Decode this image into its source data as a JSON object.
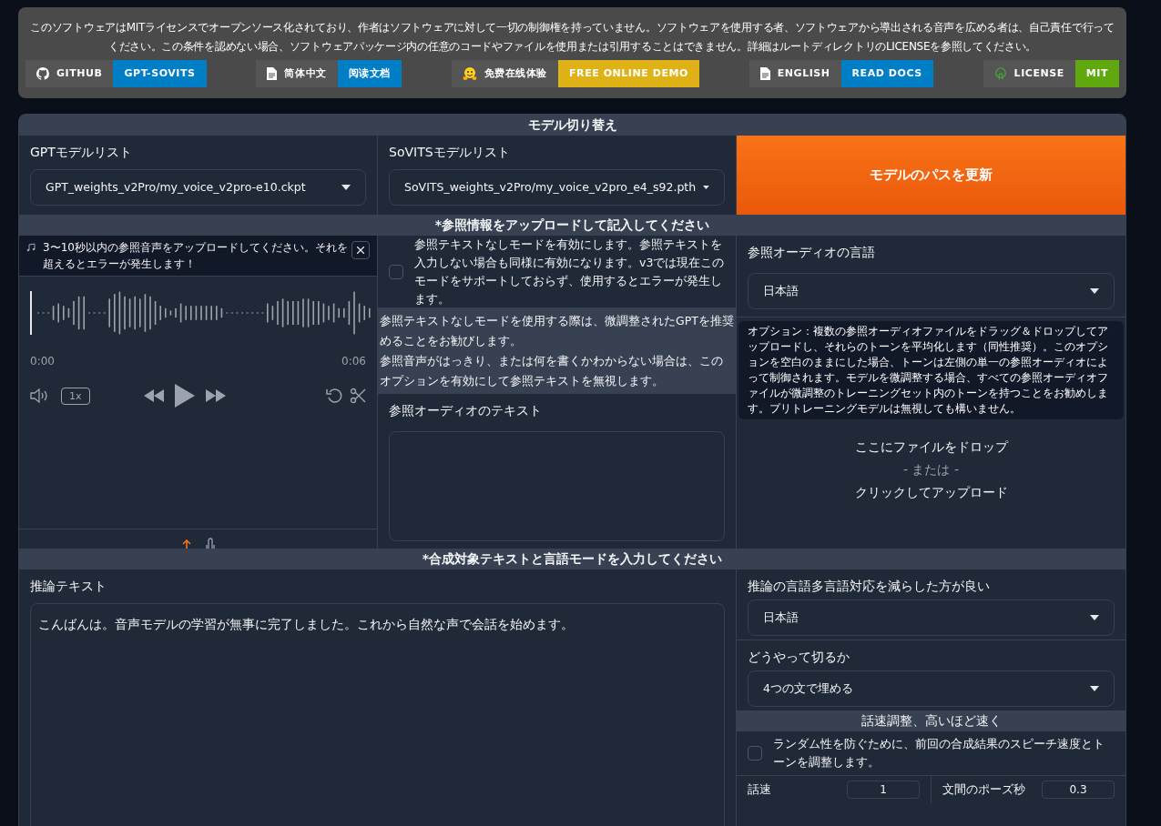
{
  "notice": "このソフトウェアはMITライセンスでオープンソース化されており、作者はソフトウェアに対して一切の制御権を持っていません。ソフトウェアを使用する者、ソフトウェアから導出される音声を広める者は、自己責任で行ってください。この条件を認めない場合、ソフトウェアパッケージ内の任意のコードやファイルを使用または引用することはできません。詳細はルートディレクトリのLICENSEを参照してください。",
  "badges": [
    {
      "kind": "github",
      "label": "GITHUB",
      "value": "GPT-SOVITS",
      "color": "#007ec6"
    },
    {
      "kind": "doc",
      "label": "简体中文",
      "value": "阅读文档",
      "color": "#007ec6"
    },
    {
      "kind": "hug",
      "label": "免费在线体验",
      "value": "FREE ONLINE DEMO",
      "color": "#dfb317"
    },
    {
      "kind": "doc",
      "label": "ENGLISH",
      "value": "READ DOCS",
      "color": "#007ec6"
    },
    {
      "kind": "license",
      "label": "LICENSE",
      "value": "MIT",
      "color": "#5fa80e"
    }
  ],
  "model_section": {
    "title": "モデル切り替え",
    "gpt": {
      "label": "GPTモデルリスト",
      "value": "GPT_weights_v2Pro/my_voice_v2pro-e10.ckpt"
    },
    "sovits": {
      "label": "SoVITSモデルリスト",
      "value": "SoVITS_weights_v2Pro/my_voice_v2pro_e4_s92.pth"
    },
    "refresh_button": "モデルのパスを更新"
  },
  "reference_section": {
    "title": "*参照情報をアップロードして記入してください",
    "audio": {
      "notice": "3〜10秒以内の参照音声をアップロードしてください。それを超えるとエラーが発生します！",
      "start_time": "0:00",
      "end_time": "0:06",
      "speed": "1x"
    },
    "no_ref_mode": {
      "label": "参照テキストなしモードを有効にします。参照テキストを入力しない場合も同様に有効になります。v3では現在このモードをサポートしておらず、使用するとエラーが発生します。",
      "checked": false
    },
    "hint": [
      "参照テキストなしモードを使用する際は、微調整されたGPTを推奨めることをお勧びします。",
      "参照音声がはっきり、または何を書くかわからない場合は、このオプションを有効にして参照テキストを無視します。"
    ],
    "ref_text": {
      "label": "参照オーディオのテキスト"
    },
    "ref_language": {
      "label": "参照オーディオの言語",
      "value": "日本語"
    },
    "tooltip": "オプション：複数の参照オーディオファイルをドラッグ＆ドロップしてアップロードし、それらのトーンを平均化します（同性推奨）。このオプションを空白のままにした場合、トーンは左側の単一の参照オーディオによって制御されます。モデルを微調整する場合、すべての参照オーディオファイルが微調整のトレーニングセット内のトーンを持つことをお勧めします。プリトレーニングモデルは無視しても構いません。",
    "dropzone": {
      "primary": "ここにファイルをドロップ",
      "or": "- または -",
      "secondary": "クリックしてアップロード"
    }
  },
  "synthesis_section": {
    "title": "*合成対象テキストと言語モードを入力してください",
    "text": {
      "label": "推論テキスト",
      "value": "こんばんは。音声モデルの学習が無事に完了しました。これから自然な声で会話を始めます。"
    },
    "language": {
      "label": "推論の言語多言語対応を減らした方が良い",
      "value": "日本語"
    },
    "split": {
      "label": "どうやって切るか",
      "value": "4つの文で埋める"
    },
    "speed_header": "話速調整、高いほど速く",
    "keep_speed": {
      "label": "ランダム性を防ぐために、前回の合成結果のスピーチ速度とトーンを調整します。",
      "checked": false
    },
    "speed": {
      "label": "話速",
      "value": "1"
    },
    "pause": {
      "label": "文間のポーズ秒",
      "value": "0.3"
    }
  }
}
